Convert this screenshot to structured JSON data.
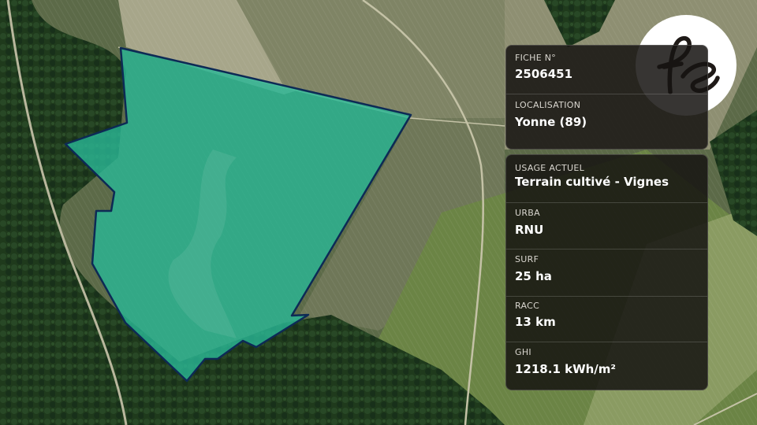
{
  "map": {
    "parcel_color": "#29b896",
    "parcel_outline": "#0d2a55"
  },
  "logo": {
    "icon": "fs-monogram-logo",
    "text": "fs"
  },
  "fiche_panel": {
    "fiche_label": "FICHE N°",
    "fiche_value": "2506451",
    "localisation_label": "LOCALISATION",
    "localisation_value": "Yonne (89)"
  },
  "details_panel": {
    "usage_label": "USAGE ACTUEL",
    "usage_value": "Terrain cultivé - Vignes",
    "urba_label": "URBA",
    "urba_value": "RNU",
    "surf_label": "SURF",
    "surf_value": "25 ha",
    "racc_label": "RACC",
    "racc_value": "13 km",
    "ghi_label": "GHI",
    "ghi_value": "1218.1 kWh/m²"
  }
}
